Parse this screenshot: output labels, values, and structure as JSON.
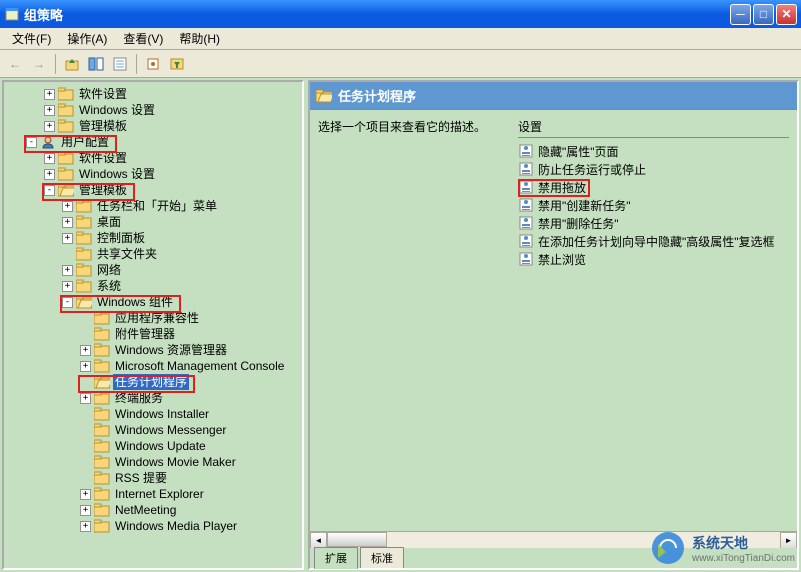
{
  "window": {
    "title": "组策略"
  },
  "menu": {
    "file": "文件(F)",
    "action": "操作(A)",
    "view": "查看(V)",
    "help": "帮助(H)"
  },
  "tree": {
    "items": [
      {
        "level": 2,
        "expander": "+",
        "icon": "folder",
        "label": "软件设置"
      },
      {
        "level": 2,
        "expander": "+",
        "icon": "folder",
        "label": "Windows 设置"
      },
      {
        "level": 2,
        "expander": "+",
        "icon": "folder",
        "label": "管理模板"
      },
      {
        "level": 1,
        "expander": "-",
        "icon": "user",
        "label": "用户配置",
        "red": "rb1"
      },
      {
        "level": 2,
        "expander": "+",
        "icon": "folder",
        "label": "软件设置"
      },
      {
        "level": 2,
        "expander": "+",
        "icon": "folder",
        "label": "Windows 设置"
      },
      {
        "level": 2,
        "expander": "-",
        "icon": "folder-open",
        "label": "管理模板",
        "red": "rb2"
      },
      {
        "level": 3,
        "expander": "+",
        "icon": "folder",
        "label": "任务栏和「开始」菜单"
      },
      {
        "level": 3,
        "expander": "+",
        "icon": "folder",
        "label": "桌面"
      },
      {
        "level": 3,
        "expander": "+",
        "icon": "folder",
        "label": "控制面板"
      },
      {
        "level": 3,
        "expander": "",
        "icon": "folder",
        "label": "共享文件夹"
      },
      {
        "level": 3,
        "expander": "+",
        "icon": "folder",
        "label": "网络"
      },
      {
        "level": 3,
        "expander": "+",
        "icon": "folder",
        "label": "系统"
      },
      {
        "level": 3,
        "expander": "-",
        "icon": "folder-open",
        "label": "Windows 组件",
        "red": "rb3"
      },
      {
        "level": 4,
        "expander": "",
        "icon": "folder",
        "label": "应用程序兼容性"
      },
      {
        "level": 4,
        "expander": "",
        "icon": "folder",
        "label": "附件管理器"
      },
      {
        "level": 4,
        "expander": "+",
        "icon": "folder",
        "label": "Windows 资源管理器"
      },
      {
        "level": 4,
        "expander": "+",
        "icon": "folder",
        "label": "Microsoft Management Console"
      },
      {
        "level": 4,
        "expander": "",
        "icon": "folder-open",
        "label": "任务计划程序",
        "selected": true,
        "red": "rb4"
      },
      {
        "level": 4,
        "expander": "+",
        "icon": "folder",
        "label": "终端服务"
      },
      {
        "level": 4,
        "expander": "",
        "icon": "folder",
        "label": "Windows Installer"
      },
      {
        "level": 4,
        "expander": "",
        "icon": "folder",
        "label": "Windows Messenger"
      },
      {
        "level": 4,
        "expander": "",
        "icon": "folder",
        "label": "Windows Update"
      },
      {
        "level": 4,
        "expander": "",
        "icon": "folder",
        "label": "Windows Movie Maker"
      },
      {
        "level": 4,
        "expander": "",
        "icon": "folder",
        "label": "RSS 提要"
      },
      {
        "level": 4,
        "expander": "+",
        "icon": "folder",
        "label": "Internet Explorer"
      },
      {
        "level": 4,
        "expander": "+",
        "icon": "folder",
        "label": "NetMeeting"
      },
      {
        "level": 4,
        "expander": "+",
        "icon": "folder",
        "label": "Windows Media Player"
      }
    ]
  },
  "detail": {
    "header_title": "任务计划程序",
    "description": "选择一个项目来查看它的描述。",
    "column_header": "设置",
    "settings": [
      {
        "label": "隐藏\"属性\"页面"
      },
      {
        "label": "防止任务运行或停止"
      },
      {
        "label": "禁用拖放",
        "red": true
      },
      {
        "label": "禁用\"创建新任务\""
      },
      {
        "label": "禁用\"删除任务\""
      },
      {
        "label": "在添加任务计划向导中隐藏\"高级属性\"复选框"
      },
      {
        "label": "禁止浏览"
      }
    ],
    "tab_extended": "扩展",
    "tab_standard": "标准"
  },
  "watermark": {
    "text": "系统天地",
    "url": "www.xiTongTianDi.com"
  }
}
